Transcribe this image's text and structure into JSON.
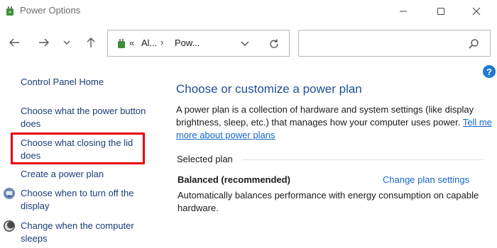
{
  "window": {
    "title": "Power Options",
    "icon": "power-options-icon"
  },
  "address_bar": {
    "chevron": "«",
    "crumbs": [
      "Al...",
      "Pow..."
    ],
    "separator": "›"
  },
  "search": {
    "value": "",
    "placeholder": ""
  },
  "left_pane": {
    "home": "Control Panel Home",
    "power_button": "Choose what the power button does",
    "closing_lid": "Choose what closing the lid does",
    "create_plan": "Create a power plan",
    "turn_off_display": "Choose when to turn off the display",
    "computer_sleeps": "Change when the computer sleeps"
  },
  "main": {
    "heading": "Choose or customize a power plan",
    "description": "A power plan is a collection of hardware and system settings (like display brightness, sleep, etc.) that manages how your computer uses power.",
    "learn_more": "Tell me more about power plans",
    "selected_plan_label": "Selected plan",
    "plan_name": "Balanced (recommended)",
    "change_settings": "Change plan settings",
    "plan_description": "Automatically balances performance with energy consumption on capable hardware."
  },
  "highlight_color": "#e8000b",
  "link_color": "#1566c9"
}
